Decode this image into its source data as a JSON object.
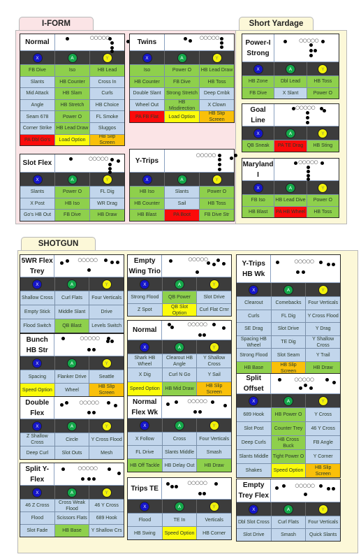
{
  "sections": {
    "iform": {
      "title": "I-FORM"
    },
    "short_yardage": {
      "title": "Short Yardage"
    },
    "shotgun": {
      "title": "SHOTGUN"
    }
  },
  "buttons": {
    "x": "X",
    "a": "A",
    "y": "Y"
  },
  "button_colors": {
    "x": "#1515c8",
    "a": "#14a84a",
    "y": "#f2f20a"
  },
  "play_type_colors": {
    "pass": "#c2d6ec",
    "run": "#8ed04c",
    "play_action": "#fb0a0a",
    "option": "#fbfb0a",
    "screen": "#f9c00a"
  },
  "formations": {
    "iform_normal": {
      "name": "Normal",
      "rows": [
        [
          [
            "FB Dive",
            "run"
          ],
          [
            "Iso",
            "run"
          ],
          [
            "HB Lead",
            "run"
          ]
        ],
        [
          [
            "Slants",
            "pass"
          ],
          [
            "HB Counter",
            "run"
          ],
          [
            "Cross In",
            "pass"
          ]
        ],
        [
          [
            "Mid Attack",
            "pass"
          ],
          [
            "HB Slam",
            "run"
          ],
          [
            "Curls",
            "pass"
          ]
        ],
        [
          [
            "Angle",
            "pass"
          ],
          [
            "HB Stretch",
            "run"
          ],
          [
            "HB Choice",
            "pass"
          ]
        ],
        [
          [
            "Seam 678",
            "pass"
          ],
          [
            "Power O",
            "run"
          ],
          [
            "FL Smoke",
            "pass"
          ]
        ],
        [
          [
            "Corner Strike",
            "pass"
          ],
          [
            "HB Lead Draw",
            "run"
          ],
          [
            "Sluggos",
            "pass"
          ]
        ],
        [
          [
            "PA Dbl Go's",
            "play_action"
          ],
          [
            "Load Option",
            "option"
          ],
          [
            "HB Slip Screen",
            "screen"
          ]
        ]
      ]
    },
    "iform_twins": {
      "name": "Twins",
      "rows": [
        [
          [
            "Iso",
            "run"
          ],
          [
            "Power O",
            "run"
          ],
          [
            "HB Lead Draw",
            "run"
          ]
        ],
        [
          [
            "HB Counter",
            "run"
          ],
          [
            "FB Dive",
            "run"
          ],
          [
            "HB Toss",
            "run"
          ]
        ],
        [
          [
            "Double Slant",
            "pass"
          ],
          [
            "Strong Stretch",
            "run"
          ],
          [
            "Deep Cmbk",
            "pass"
          ]
        ],
        [
          [
            "Wheel Out",
            "pass"
          ],
          [
            "HB Misdirection",
            "run"
          ],
          [
            "X Clown",
            "pass"
          ]
        ],
        [
          [
            "PA FB Flat",
            "play_action"
          ],
          [
            "Load Option",
            "option"
          ],
          [
            "HB Slip Screen",
            "screen"
          ]
        ]
      ]
    },
    "iform_slot_flex": {
      "name": "Slot Flex",
      "rows": [
        [
          [
            "Slants",
            "pass"
          ],
          [
            "Power O",
            "run"
          ],
          [
            "FL Dig",
            "pass"
          ]
        ],
        [
          [
            "X Post",
            "pass"
          ],
          [
            "HB Iso",
            "run"
          ],
          [
            "WR Drag",
            "pass"
          ]
        ],
        [
          [
            "Go's HB Out",
            "pass"
          ],
          [
            "FB Dive",
            "run"
          ],
          [
            "HB Draw",
            "run"
          ]
        ]
      ]
    },
    "iform_y_trips": {
      "name": "Y-Trips",
      "rows": [
        [
          [
            "HB Iso",
            "run"
          ],
          [
            "Slants",
            "pass"
          ],
          [
            "Power O",
            "run"
          ]
        ],
        [
          [
            "HB Counter",
            "run"
          ],
          [
            "Sail",
            "pass"
          ],
          [
            "HB Toss",
            "run"
          ]
        ],
        [
          [
            "HB Blast",
            "run"
          ],
          [
            "PA Boot",
            "play_action"
          ],
          [
            "FB Dive Str",
            "run"
          ]
        ]
      ]
    },
    "sy_power_i_strong": {
      "name": "Power-I Strong",
      "rows": [
        [
          [
            "HB Zone",
            "run"
          ],
          [
            "Dbl Lead",
            "run"
          ],
          [
            "HB Toss",
            "run"
          ]
        ],
        [
          [
            "FB Dive",
            "run"
          ],
          [
            "X Slant",
            "pass"
          ],
          [
            "Power O",
            "run"
          ]
        ]
      ]
    },
    "sy_goal_line": {
      "name": "Goal Line",
      "rows": [
        [
          [
            "QB Sneak",
            "run"
          ],
          [
            "PA TE Drag",
            "play_action"
          ],
          [
            "HB Sting",
            "run"
          ]
        ]
      ]
    },
    "sy_maryland_i": {
      "name": "Maryland I",
      "rows": [
        [
          [
            "FB Iso",
            "run"
          ],
          [
            "HB Lead Dive",
            "run"
          ],
          [
            "Power O",
            "run"
          ]
        ],
        [
          [
            "HB Blast",
            "run"
          ],
          [
            "PA HB Wheel",
            "play_action"
          ],
          [
            "HB Toss",
            "run"
          ]
        ]
      ]
    },
    "sg_5wr_flex_trey": {
      "name": "5WR Flex Trey",
      "rows": [
        [
          [
            "Shallow Cross",
            "pass"
          ],
          [
            "Curl Flats",
            "pass"
          ],
          [
            "Four Verticals",
            "pass"
          ]
        ],
        [
          [
            "Empty Stick",
            "pass"
          ],
          [
            "Middle Slant",
            "pass"
          ],
          [
            "Drive",
            "pass"
          ]
        ],
        [
          [
            "Flood Switch",
            "pass"
          ],
          [
            "QB Blast",
            "run"
          ],
          [
            "Levels Switch",
            "pass"
          ]
        ]
      ]
    },
    "sg_bunch_hb_str": {
      "name": "Bunch HB Str",
      "rows": [
        [
          [
            "Spacing",
            "pass"
          ],
          [
            "Flanker Drive",
            "pass"
          ],
          [
            "Seattle",
            "pass"
          ]
        ],
        [
          [
            "Speed Option",
            "option"
          ],
          [
            "Wheel",
            "pass"
          ],
          [
            "HB Slip Screen",
            "screen"
          ]
        ]
      ]
    },
    "sg_double_flex": {
      "name": "Double Flex",
      "rows": [
        [
          [
            "Z Shallow Cross",
            "pass"
          ],
          [
            "Circle",
            "pass"
          ],
          [
            "Y Cross Flood",
            "pass"
          ]
        ],
        [
          [
            "Deep Curl",
            "pass"
          ],
          [
            "Slot Outs",
            "pass"
          ],
          [
            "Mesh",
            "pass"
          ]
        ]
      ]
    },
    "sg_split_y_flex": {
      "name": "Split Y-Flex",
      "rows": [
        [
          [
            "46 Z Cross",
            "pass"
          ],
          [
            "Cross Weak Flood",
            "pass"
          ],
          [
            "46 Y Cross",
            "pass"
          ]
        ],
        [
          [
            "Flood",
            "pass"
          ],
          [
            "Scissors Flats",
            "pass"
          ],
          [
            "689 Hook",
            "pass"
          ]
        ],
        [
          [
            "Slot Fade",
            "pass"
          ],
          [
            "HB Base",
            "run"
          ],
          [
            "Y Shallow Crs",
            "pass"
          ]
        ]
      ]
    },
    "sg_empty_wing_trio": {
      "name": "Empty Wing Trio",
      "rows": [
        [
          [
            "Strong Flood",
            "pass"
          ],
          [
            "QB Power",
            "run"
          ],
          [
            "Slot Drive",
            "pass"
          ]
        ],
        [
          [
            "Z Spot",
            "pass"
          ],
          [
            "QB Slot Option",
            "option"
          ],
          [
            "Curl Flat Crnr",
            "pass"
          ]
        ]
      ]
    },
    "sg_normal": {
      "name": "Normal",
      "rows": [
        [
          [
            "Shark HB Wheel",
            "pass"
          ],
          [
            "Clearout HB Angle",
            "pass"
          ],
          [
            "Y Shallow Cross",
            "pass"
          ]
        ],
        [
          [
            "X Dig",
            "pass"
          ],
          [
            "Curl N Go",
            "pass"
          ],
          [
            "Y Sail",
            "pass"
          ]
        ],
        [
          [
            "Speed Option",
            "option"
          ],
          [
            "HB Mid Draw",
            "run"
          ],
          [
            "HB Slip Screen",
            "screen"
          ]
        ]
      ]
    },
    "sg_normal_flex_wk": {
      "name": "Normal Flex Wk",
      "rows": [
        [
          [
            "X Follow",
            "pass"
          ],
          [
            "Cross",
            "pass"
          ],
          [
            "Four Verticals",
            "pass"
          ]
        ],
        [
          [
            "FL Drive",
            "pass"
          ],
          [
            "Slants Middle",
            "pass"
          ],
          [
            "Smash",
            "pass"
          ]
        ],
        [
          [
            "HB Off Tackle",
            "run"
          ],
          [
            "HB Delay Out",
            "pass"
          ],
          [
            "HB Draw",
            "run"
          ]
        ]
      ]
    },
    "sg_trips_te": {
      "name": "Trips TE",
      "rows": [
        [
          [
            "Flood",
            "pass"
          ],
          [
            "TE In",
            "pass"
          ],
          [
            "Verticals",
            "pass"
          ]
        ],
        [
          [
            "HB Swing",
            "pass"
          ],
          [
            "Speed Option",
            "option"
          ],
          [
            "HB Corner",
            "pass"
          ]
        ]
      ]
    },
    "sg_y_trips_hb_wk": {
      "name": "Y-Trips HB Wk",
      "rows": [
        [
          [
            "Clearout",
            "pass"
          ],
          [
            "Comebacks",
            "pass"
          ],
          [
            "Four Verticals",
            "pass"
          ]
        ],
        [
          [
            "Curls",
            "pass"
          ],
          [
            "FL Dig",
            "pass"
          ],
          [
            "Y Cross Flood",
            "pass"
          ]
        ],
        [
          [
            "SE Drag",
            "pass"
          ],
          [
            "Slot Drive",
            "pass"
          ],
          [
            "Y Drag",
            "pass"
          ]
        ],
        [
          [
            "Spacing HB Wheel",
            "pass"
          ],
          [
            "TE Dig",
            "pass"
          ],
          [
            "Y Shallow Cross",
            "pass"
          ]
        ],
        [
          [
            "Strong Flood",
            "pass"
          ],
          [
            "Slot Seam",
            "pass"
          ],
          [
            "Y Trail",
            "pass"
          ]
        ],
        [
          [
            "HB Base",
            "run"
          ],
          [
            "HB Slip Screen",
            "screen"
          ],
          [
            "HB Draw",
            "run"
          ]
        ]
      ]
    },
    "sg_split_offset": {
      "name": "Split Offset",
      "rows": [
        [
          [
            "689 Hook",
            "pass"
          ],
          [
            "HB Power O",
            "run"
          ],
          [
            "Y Cross",
            "pass"
          ]
        ],
        [
          [
            "Slot Post",
            "pass"
          ],
          [
            "Counter Trey",
            "run"
          ],
          [
            "46 Y Cross",
            "pass"
          ]
        ],
        [
          [
            "Deep Curls",
            "pass"
          ],
          [
            "HB Cross Buck",
            "run"
          ],
          [
            "FB Angle",
            "pass"
          ]
        ],
        [
          [
            "Slants Middle",
            "pass"
          ],
          [
            "Tight Power O",
            "run"
          ],
          [
            "Y Corner",
            "pass"
          ]
        ],
        [
          [
            "Shakes",
            "pass"
          ],
          [
            "Speed Option",
            "option"
          ],
          [
            "HB Slip Screen",
            "screen"
          ]
        ]
      ]
    },
    "sg_empty_trey_flex": {
      "name": "Empty Trey Flex",
      "rows": [
        [
          [
            "Dbl Slot Cross",
            "pass"
          ],
          [
            "Curl Flats",
            "pass"
          ],
          [
            "Four Verticals",
            "pass"
          ]
        ],
        [
          [
            "Slot Drive",
            "pass"
          ],
          [
            "Smash",
            "pass"
          ],
          [
            "Quick Slants",
            "pass"
          ]
        ]
      ]
    }
  },
  "line_glyph": "○○○○○"
}
